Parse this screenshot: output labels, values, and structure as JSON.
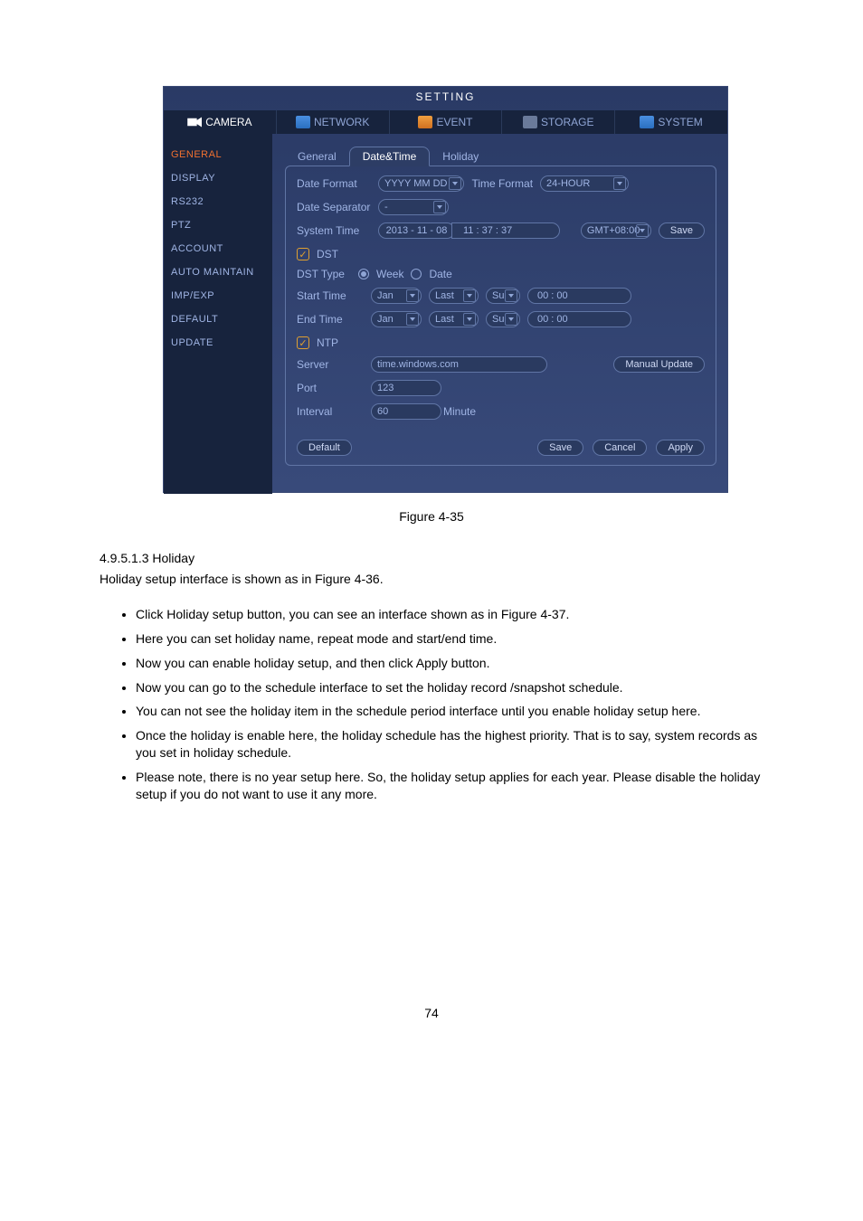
{
  "window": {
    "title": "SETTING"
  },
  "topnav": {
    "camera": "CAMERA",
    "network": "NETWORK",
    "event": "EVENT",
    "storage": "STORAGE",
    "system": "SYSTEM"
  },
  "sidebar": [
    "GENERAL",
    "DISPLAY",
    "RS232",
    "PTZ",
    "ACCOUNT",
    "AUTO MAINTAIN",
    "IMP/EXP",
    "DEFAULT",
    "UPDATE"
  ],
  "tabs": {
    "general": "General",
    "datetime": "Date&Time",
    "holiday": "Holiday"
  },
  "fields": {
    "date_format_label": "Date Format",
    "date_format_value": "YYYY MM DD",
    "time_format_label": "Time Format",
    "time_format_value": "24-HOUR",
    "date_sep_label": "Date Separator",
    "date_sep_value": "-",
    "system_time_label": "System Time",
    "system_date": "2013 - 11 - 08",
    "system_clock": "11 : 37 : 37",
    "gmt": "GMT+08:00",
    "save_small": "Save",
    "dst_label": "DST",
    "dst_type_label": "DST Type",
    "dst_week": "Week",
    "dst_date": "Date",
    "start_label": "Start Time",
    "end_label": "End Time",
    "month": "Jan",
    "week": "Last",
    "day": "Su",
    "hhmm": "00 :   00",
    "ntp_label": "NTP",
    "server_label": "Server",
    "server_value": "time.windows.com",
    "manual_update": "Manual Update",
    "port_label": "Port",
    "port_value": "123",
    "interval_label": "Interval",
    "interval_value": "60",
    "interval_unit": "Minute"
  },
  "buttons": {
    "default": "Default",
    "save": "Save",
    "cancel": "Cancel",
    "apply": "Apply"
  },
  "doc": {
    "figure_caption": "Figure 4-35",
    "section_heading": "4.9.5.1.3 Holiday",
    "intro": "Holiday setup interface is shown as in Figure 4-36.",
    "bullets": [
      "Click Holiday setup button, you can see an interface shown as in Figure 4-37.",
      "Here you can set holiday name, repeat mode and start/end time.",
      "Now you can enable holiday setup, and then click Apply button.",
      "Now you can go to the schedule interface to set the holiday record /snapshot schedule.",
      "You can not see the holiday item in the schedule period interface until you enable holiday setup here.",
      "Once the holiday is enable here, the holiday schedule has the highest priority. That is to say, system records as you set in holiday schedule.",
      "Please note, there is no year setup here. So, the holiday setup applies for each year. Please disable the holiday setup if you do not want to use it any more."
    ],
    "page_number": "74"
  }
}
